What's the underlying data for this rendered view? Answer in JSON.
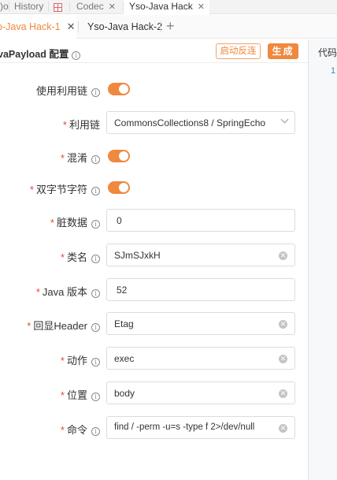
{
  "top_tabs": {
    "history_label": "History",
    "codec_label": "Codec",
    "yso_label": "Yso-Java Hack"
  },
  "sub_tabs": {
    "tab1_label": "o-Java Hack-1",
    "tab2_label": "Yso-Java Hack-2"
  },
  "header": {
    "title": "vaPayload 配置",
    "reverse_button": "启动反连",
    "generate_button": "生成"
  },
  "code_pane": {
    "title": "代码",
    "line_number": "1"
  },
  "form": {
    "use_chain": {
      "label": "使用利用链",
      "enabled": true
    },
    "chain": {
      "label": "利用链",
      "value": "CommonsCollections8 / SpringEcho"
    },
    "obfuscate": {
      "label": "混淆",
      "enabled": true
    },
    "double_byte": {
      "label": "双字节字符",
      "enabled": true
    },
    "dirty_data": {
      "label": "脏数据",
      "value": "0"
    },
    "class_name": {
      "label": "类名",
      "value": "SJmSJxkH"
    },
    "java_version": {
      "label": "Java 版本",
      "value": "52"
    },
    "echo_header": {
      "label": "回显Header",
      "value": "Etag"
    },
    "action": {
      "label": "动作",
      "value": "exec"
    },
    "position": {
      "label": "位置",
      "value": "body"
    },
    "command": {
      "label": "命令",
      "value": "find / -perm -u=s -type f 2>/dev/null"
    }
  },
  "icons": {
    "info": "info-circle-icon",
    "clear": "clear-circle-icon",
    "dropdown": "chevron-down-icon",
    "close": "close-icon",
    "add": "plus-icon",
    "table": "table-grid-icon"
  },
  "colors": {
    "accent": "#f0883e",
    "required": "#e8463c"
  }
}
